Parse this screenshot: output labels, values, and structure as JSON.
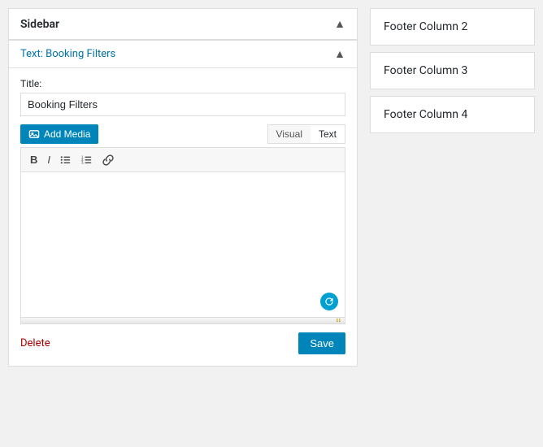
{
  "sidebar": {
    "title": "Sidebar",
    "chevron": "▲"
  },
  "widget": {
    "subheader_prefix": "Text: ",
    "subheader_value": "Booking Filters",
    "chevron": "▲",
    "title_label": "Title:",
    "title_value": "Booking Filters",
    "add_media_label": "Add Media",
    "view_tab_visual": "Visual",
    "view_tab_text": "Text",
    "toolbar_bold": "B",
    "toolbar_italic": "I",
    "toolbar_ul": "≡",
    "toolbar_ol": "≡",
    "toolbar_link": "🔗",
    "delete_label": "Delete",
    "save_label": "Save"
  },
  "footer_columns": [
    {
      "label": "Footer Column 2"
    },
    {
      "label": "Footer Column 3"
    },
    {
      "label": "Footer Column 4"
    }
  ]
}
